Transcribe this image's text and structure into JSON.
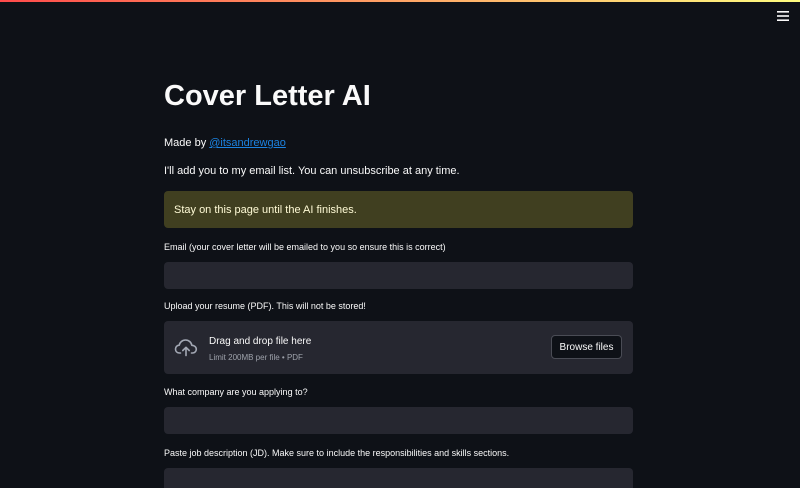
{
  "header": {
    "menu_icon": "hamburger-menu-icon",
    "decoration_colors": [
      "#ff4b4b",
      "#fffd80"
    ]
  },
  "main": {
    "title": "Cover Letter AI",
    "made_by_prefix": "Made by ",
    "made_by_link": "@itsandrewgao",
    "email_list_note": "I'll add you to my email list. You can unsubscribe at any time.",
    "warning": "Stay on this page until the AI finishes.",
    "email_label": "Email (your cover letter will be emailed to you so ensure this is correct)",
    "email_value": "",
    "upload_label": "Upload your resume (PDF). This will not be stored!",
    "dropzone": {
      "icon": "cloud-upload-icon",
      "title": "Drag and drop file here",
      "limit": "Limit 200MB per file • PDF",
      "browse_label": "Browse files"
    },
    "company_label": "What company are you applying to?",
    "company_value": "",
    "jd_label": "Paste job description (JD). Make sure to include the responsibilities and skills sections.",
    "jd_value": ""
  },
  "colors": {
    "background": "#0e1117",
    "input_background": "#262730",
    "warning_background": "#403f20",
    "warning_text": "#fffbd6",
    "link": "#1c83e1"
  }
}
